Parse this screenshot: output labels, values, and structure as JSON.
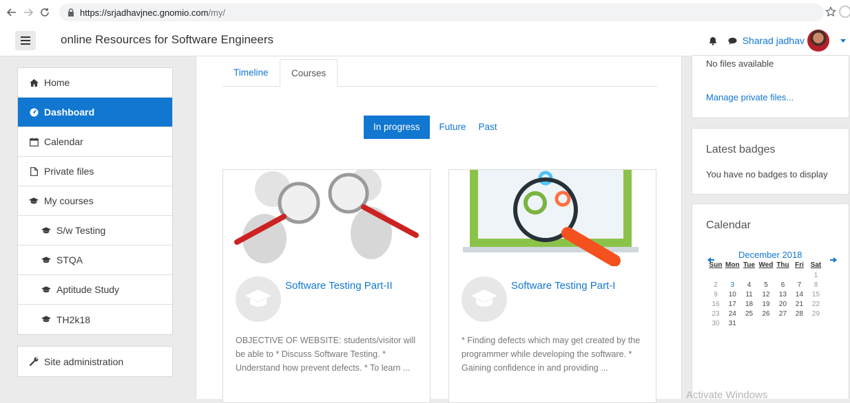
{
  "browser": {
    "url_host": "https://srjadhavjnec.gnomio.com",
    "url_path": "/my/"
  },
  "header": {
    "site_title": "online Resources for Software Engineers",
    "user_name": "Sharad jadhav"
  },
  "sidebar": {
    "items": [
      {
        "label": "Home",
        "icon": "home-icon"
      },
      {
        "label": "Dashboard",
        "icon": "dashboard-icon",
        "active": true
      },
      {
        "label": "Calendar",
        "icon": "calendar-icon"
      },
      {
        "label": "Private files",
        "icon": "file-icon"
      },
      {
        "label": "My courses",
        "icon": "graduation-cap-icon"
      },
      {
        "label": "S/w Testing",
        "icon": "graduation-cap-icon"
      },
      {
        "label": "STQA",
        "icon": "graduation-cap-icon"
      },
      {
        "label": "Aptitude Study",
        "icon": "graduation-cap-icon"
      },
      {
        "label": "TH2k18",
        "icon": "graduation-cap-icon"
      }
    ],
    "admin_label": "Site administration"
  },
  "main": {
    "tabs": [
      {
        "label": "Timeline"
      },
      {
        "label": "Courses",
        "active": true
      }
    ],
    "filters": [
      {
        "label": "In progress",
        "active": true
      },
      {
        "label": "Future"
      },
      {
        "label": "Past"
      }
    ],
    "courses": [
      {
        "title": "Software Testing Part-II",
        "description": "OBJECTIVE OF WEBSITE: students/visitor will be able to * Discuss Software Testing. * Understand how  prevent defects. * To learn ..."
      },
      {
        "title": "Software Testing Part-I",
        "description": "* Finding defects which may get created by the programmer while developing the software. * Gaining confidence in and providing ..."
      }
    ]
  },
  "right": {
    "files": {
      "empty_text": "No files available",
      "manage_link": "Manage private files..."
    },
    "badges": {
      "title": "Latest badges",
      "empty_text": "You have no badges to display"
    },
    "calendar": {
      "title": "Calendar",
      "month": "December 2018",
      "weekdays": [
        "Sun",
        "Mon",
        "Tue",
        "Wed",
        "Thu",
        "Fri",
        "Sat"
      ],
      "weeks": [
        [
          "",
          "",
          "",
          "",
          "",
          "",
          "1"
        ],
        [
          "2",
          "3",
          "4",
          "5",
          "6",
          "7",
          "8"
        ],
        [
          "9",
          "10",
          "11",
          "12",
          "13",
          "14",
          "15"
        ],
        [
          "16",
          "17",
          "18",
          "19",
          "20",
          "21",
          "22"
        ],
        [
          "23",
          "24",
          "25",
          "26",
          "27",
          "28",
          "29"
        ],
        [
          "30",
          "31",
          "",
          "",
          "",
          "",
          ""
        ]
      ]
    }
  },
  "watermark": "Activate Windows",
  "colors": {
    "accent": "#1177d1",
    "background": "#ebebeb"
  }
}
